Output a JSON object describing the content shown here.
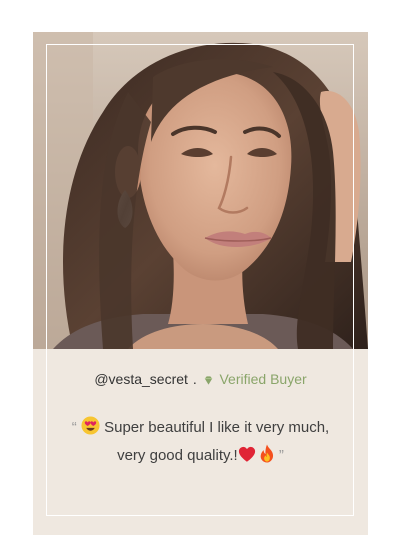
{
  "review_card": {
    "handle": "@vesta_secret",
    "separator": ".",
    "verified_label": "Verified Buyer",
    "open_quote": "“",
    "close_quote": "”",
    "text_line1": "Super beautiful I like it very much,",
    "text_line2": "very good quality.!",
    "icons": {
      "verified": "diamond-icon",
      "emoji_1": "heart-eyes-emoji-icon",
      "emoji_2": "red-heart-emoji-icon",
      "emoji_3": "fire-emoji-icon"
    },
    "colors": {
      "card_background": "#efe8e0",
      "verified_green": "#8aa56a",
      "frame_line": "#ffffff"
    }
  }
}
